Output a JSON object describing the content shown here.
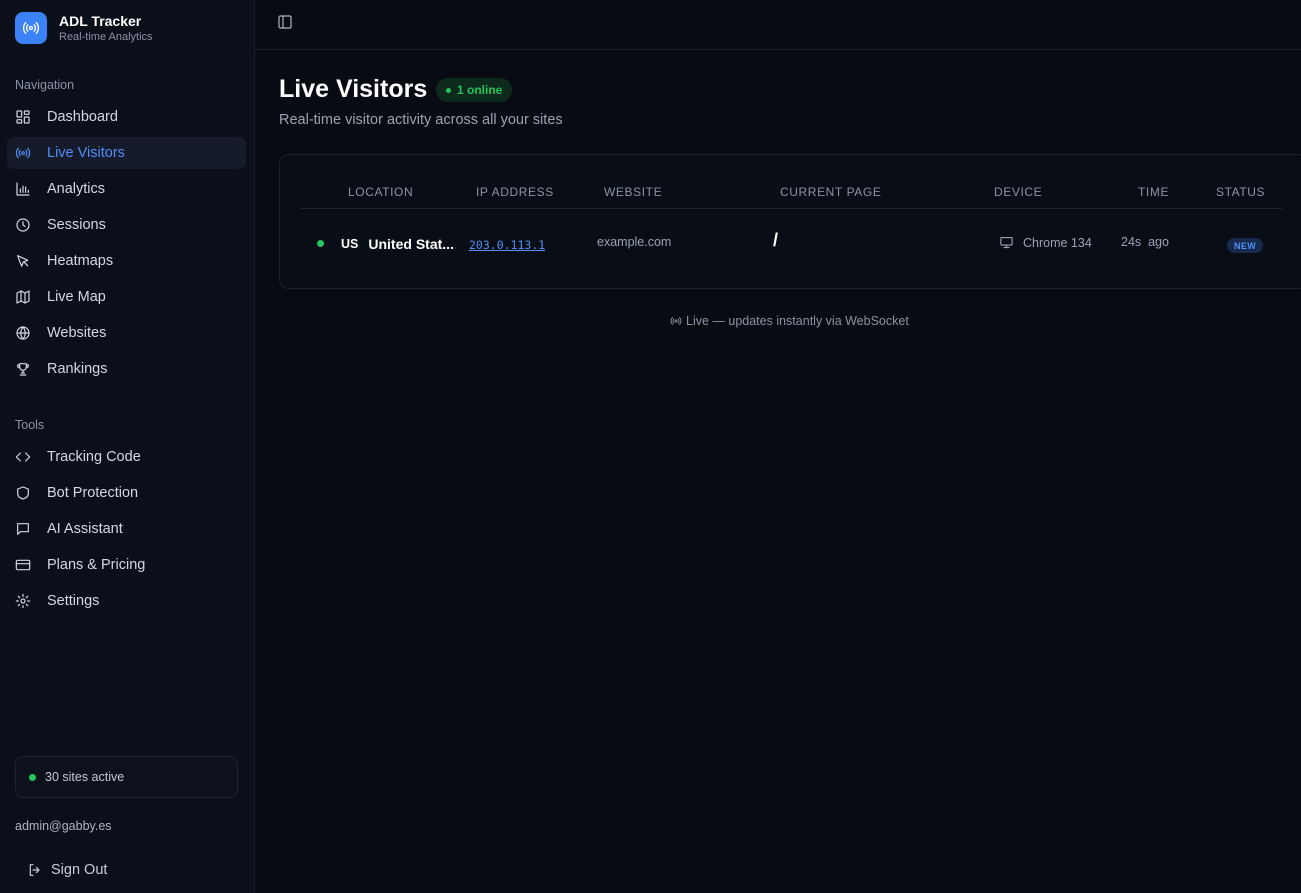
{
  "brand": {
    "name": "ADL Tracker",
    "subtitle": "Real-time Analytics"
  },
  "sidebar": {
    "navigation_label": "Navigation",
    "nav_items": [
      {
        "label": "Dashboard",
        "icon": "dashboard-icon",
        "active": false
      },
      {
        "label": "Live Visitors",
        "icon": "radio-icon",
        "active": true
      },
      {
        "label": "Analytics",
        "icon": "bar-chart-icon",
        "active": false
      },
      {
        "label": "Sessions",
        "icon": "clock-icon",
        "active": false
      },
      {
        "label": "Heatmaps",
        "icon": "pointer-icon",
        "active": false
      },
      {
        "label": "Live Map",
        "icon": "map-icon",
        "active": false
      },
      {
        "label": "Websites",
        "icon": "globe-icon",
        "active": false
      },
      {
        "label": "Rankings",
        "icon": "trophy-icon",
        "active": false
      }
    ],
    "tools_label": "Tools",
    "tool_items": [
      {
        "label": "Tracking Code",
        "icon": "code-icon"
      },
      {
        "label": "Bot Protection",
        "icon": "shield-icon"
      },
      {
        "label": "AI Assistant",
        "icon": "message-icon"
      },
      {
        "label": "Plans & Pricing",
        "icon": "credit-card-icon"
      },
      {
        "label": "Settings",
        "icon": "gear-icon"
      }
    ],
    "sites_active": "30 sites active",
    "user_email": "admin@gabby.es",
    "sign_out": "Sign Out"
  },
  "main": {
    "title": "Live Visitors",
    "online_badge": "1 online",
    "subtitle": "Real-time visitor activity across all your sites",
    "table": {
      "columns": [
        "LOCATION",
        "IP ADDRESS",
        "WEBSITE",
        "CURRENT PAGE",
        "DEVICE",
        "TIME",
        "STATUS"
      ],
      "rows": [
        {
          "country_code": "US",
          "location": "United Stat...",
          "ip": "203.0.113.1",
          "website": "example.com",
          "page": "/",
          "device": "Chrome 134",
          "time": "24s  ago",
          "status": "NEW"
        }
      ]
    },
    "footer_note": "Live — updates instantly via WebSocket"
  },
  "colors": {
    "accent": "#4f8ff7",
    "online": "#22c55e",
    "background": "#080b12"
  }
}
